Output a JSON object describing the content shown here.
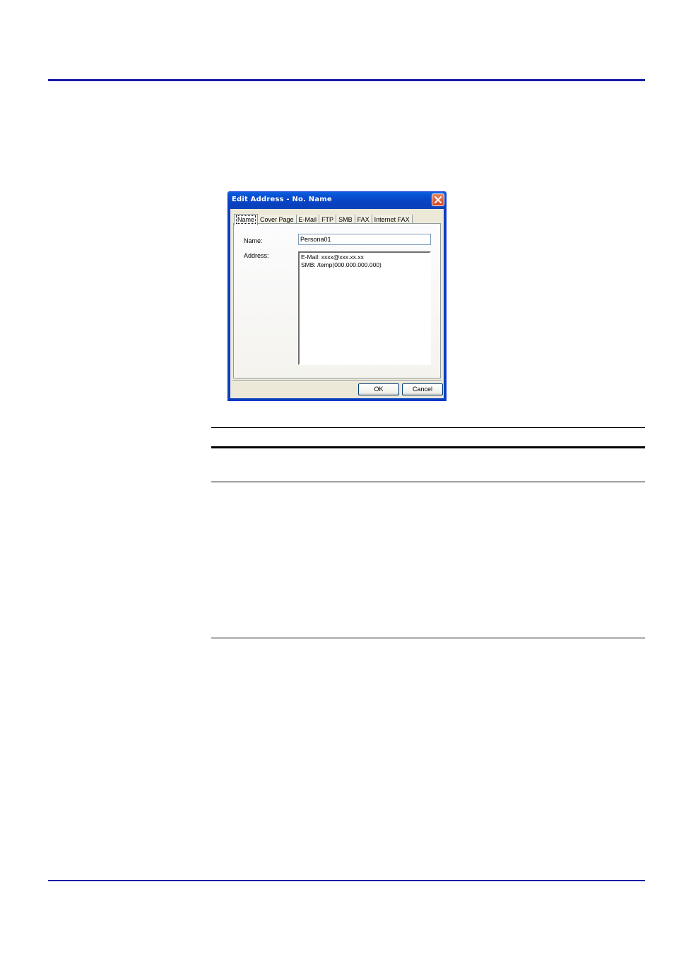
{
  "dialog": {
    "title": "Edit Address - No. Name",
    "tabs": [
      {
        "label": "Name",
        "active": true
      },
      {
        "label": "Cover Page"
      },
      {
        "label": "E-Mail"
      },
      {
        "label": "FTP"
      },
      {
        "label": "SMB"
      },
      {
        "label": "FAX"
      },
      {
        "label": "Internet FAX"
      }
    ],
    "name_label": "Name:",
    "name_value": "Persona01",
    "address_label": "Address:",
    "address_lines": [
      "E-Mail: xxxx@xxx.xx.xx",
      "SMB: /temp(000.000.000.000)"
    ],
    "ok_label": "OK",
    "cancel_label": "Cancel"
  },
  "colors": {
    "page_rule": "#1a1aa6",
    "titlebar": "#0846c6",
    "dialog_bg": "#ece9d8",
    "close_button": "#d2431c"
  },
  "icons": {
    "close": "close-icon"
  }
}
